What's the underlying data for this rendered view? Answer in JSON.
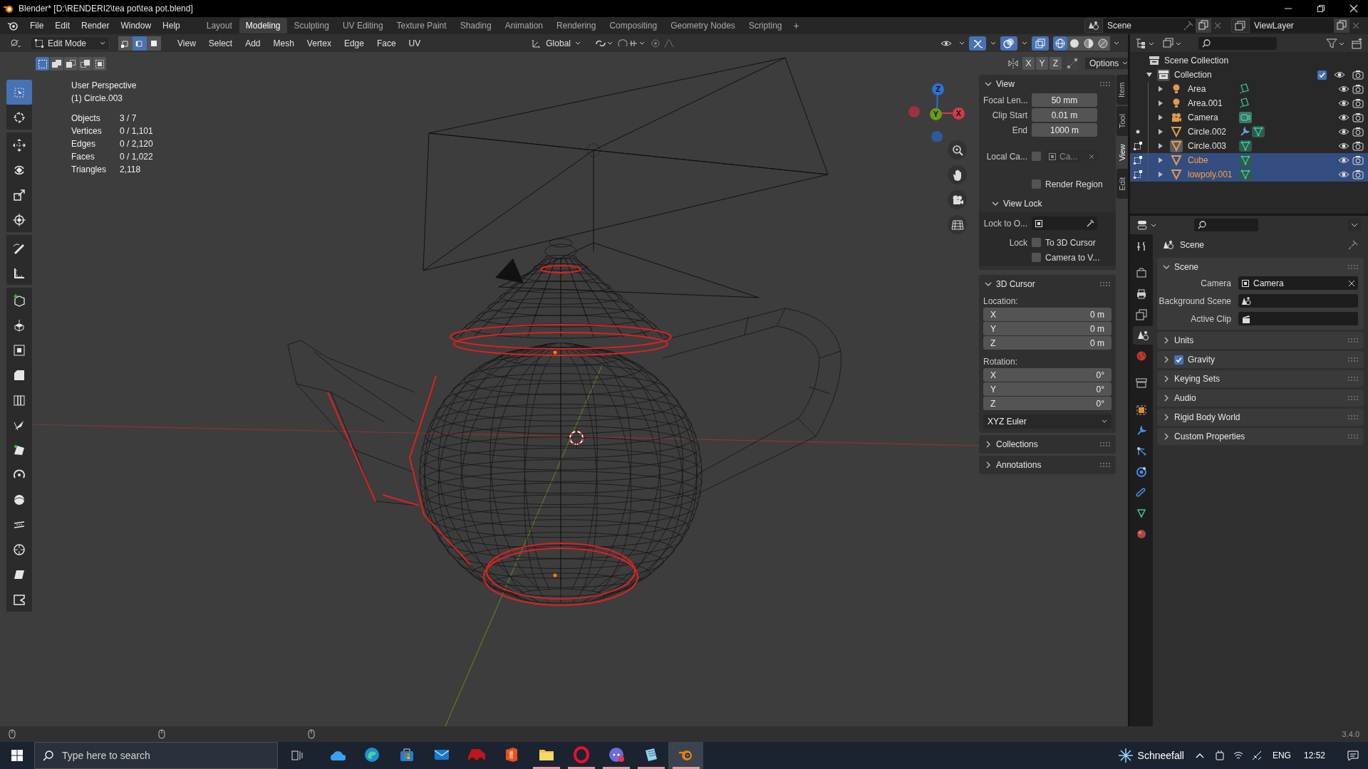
{
  "window": {
    "title": "Blender* [D:\\RENDERI2\\tea pot\\tea pot.blend]"
  },
  "menu": [
    "File",
    "Edit",
    "Render",
    "Window",
    "Help"
  ],
  "workspaces": [
    {
      "label": "Layout",
      "selected": false
    },
    {
      "label": "Modeling",
      "selected": true
    },
    {
      "label": "Sculpting",
      "selected": false
    },
    {
      "label": "UV Editing",
      "selected": false
    },
    {
      "label": "Texture Paint",
      "selected": false
    },
    {
      "label": "Shading",
      "selected": false
    },
    {
      "label": "Animation",
      "selected": false
    },
    {
      "label": "Rendering",
      "selected": false
    },
    {
      "label": "Compositing",
      "selected": false
    },
    {
      "label": "Geometry Nodes",
      "selected": false
    },
    {
      "label": "Scripting",
      "selected": false
    }
  ],
  "add_workspace": "+",
  "scene": {
    "name": "Scene"
  },
  "view_layer": {
    "name": "ViewLayer"
  },
  "viewport_header": {
    "mode": "Edit Mode",
    "select_modes": [
      {
        "kind": "vertex",
        "selected": false
      },
      {
        "kind": "edge",
        "selected": true
      },
      {
        "kind": "face",
        "selected": false
      }
    ],
    "menus": [
      "View",
      "Select",
      "Add",
      "Mesh",
      "Vertex",
      "Edge",
      "Face",
      "UV"
    ],
    "orientation": "Global",
    "toggles": [
      {
        "kind": "visibility",
        "on": false
      },
      {
        "kind": "gizmo",
        "on": true
      },
      {
        "kind": "overlay",
        "on": true
      },
      {
        "kind": "xray",
        "on": true
      }
    ],
    "shading": [
      {
        "kind": "wireframe",
        "selected": true
      },
      {
        "kind": "solid",
        "selected": false
      },
      {
        "kind": "material",
        "selected": false
      },
      {
        "kind": "rendered",
        "selected": false
      }
    ],
    "select_boxes": [
      {
        "kind": "new",
        "selected": true
      },
      {
        "kind": "extend",
        "selected": false
      },
      {
        "kind": "subtract",
        "selected": false
      },
      {
        "kind": "invert",
        "selected": false
      },
      {
        "kind": "intersect",
        "selected": false
      }
    ],
    "mirror_axes": [
      {
        "label": "X",
        "selected": false
      },
      {
        "label": "Y",
        "selected": false
      },
      {
        "label": "Z",
        "selected": false
      }
    ],
    "options": "Options"
  },
  "overlay_info": {
    "view": "User Perspective",
    "object": "(1) Circle.003",
    "stats": [
      {
        "label": "Objects",
        "value": "3 / 7"
      },
      {
        "label": "Vertices",
        "value": "0 / 1,101"
      },
      {
        "label": "Edges",
        "value": "0 / 2,120"
      },
      {
        "label": "Faces",
        "value": "0 / 1,022"
      },
      {
        "label": "Triangles",
        "value": "2,118"
      }
    ]
  },
  "tools": [
    {
      "kind": "select",
      "selected": true
    },
    {
      "kind": "cursor",
      "selected": false
    },
    {
      "kind": "move",
      "selected": false
    },
    {
      "kind": "rotate",
      "selected": false
    },
    {
      "kind": "scale",
      "selected": false
    },
    {
      "kind": "transform",
      "selected": false
    },
    {
      "kind": "annotate",
      "selected": false
    },
    {
      "kind": "measure",
      "selected": false
    },
    {
      "kind": "add_cube",
      "selected": false
    },
    {
      "kind": "extrude",
      "selected": false
    },
    {
      "kind": "inset",
      "selected": false
    },
    {
      "kind": "bevel",
      "selected": false
    },
    {
      "kind": "loop_cut",
      "selected": false
    },
    {
      "kind": "knife",
      "selected": false
    },
    {
      "kind": "poly_build",
      "selected": false
    },
    {
      "kind": "spin",
      "selected": false
    },
    {
      "kind": "smooth",
      "selected": false
    },
    {
      "kind": "edge_slide",
      "selected": false
    },
    {
      "kind": "shrink",
      "selected": false
    },
    {
      "kind": "shear",
      "selected": false
    },
    {
      "kind": "rip",
      "selected": false
    }
  ],
  "nav_gizmo": [
    {
      "label": "Z",
      "color": "#2f6fd0"
    },
    {
      "label": "Y",
      "color": "#6a9a1f"
    },
    {
      "label": "X",
      "color": "#d43a4a"
    }
  ],
  "n_panel": {
    "tabs": [
      {
        "label": "Item",
        "selected": false
      },
      {
        "label": "Tool",
        "selected": false
      },
      {
        "label": "View",
        "selected": true
      },
      {
        "label": "Edit",
        "selected": false
      }
    ],
    "view": {
      "title": "View",
      "expanded": true,
      "fields": [
        {
          "label": "Focal Len...",
          "value": "50 mm"
        },
        {
          "label": "Clip Start",
          "value": "0.01 m"
        },
        {
          "label": "End",
          "value": "1000 m"
        }
      ],
      "local_camera": {
        "label": "Local Ca...",
        "checked": false,
        "value": "Ca..."
      },
      "render_region": {
        "label": "Render Region",
        "checked": false
      }
    },
    "view_lock": {
      "title": "View Lock",
      "expanded": true,
      "lock_to_object": "Lock to O...",
      "lock_label": "Lock",
      "checks": [
        {
          "label": "To 3D Cursor",
          "checked": false
        },
        {
          "label": "Camera to V...",
          "checked": false
        }
      ]
    },
    "cursor": {
      "title": "3D Cursor",
      "expanded": true,
      "location_label": "Location:",
      "location": [
        {
          "axis": "X",
          "value": "0 m"
        },
        {
          "axis": "Y",
          "value": "0 m"
        },
        {
          "axis": "Z",
          "value": "0 m"
        }
      ],
      "rotation_label": "Rotation:",
      "rotation": [
        {
          "axis": "X",
          "value": "0°"
        },
        {
          "axis": "Y",
          "value": "0°"
        },
        {
          "axis": "Z",
          "value": "0°"
        }
      ],
      "rotation_mode": "XYZ Euler"
    },
    "collapsed": [
      {
        "title": "Collections",
        "expanded": false
      },
      {
        "title": "Annotations",
        "expanded": false
      }
    ]
  },
  "outliner": {
    "root": "Scene Collection",
    "collection": {
      "name": "Collection",
      "expanded": true,
      "checked": true,
      "children": [
        {
          "name": "Area",
          "kind": "light",
          "in_edit_mode": false,
          "editable": false,
          "active": false,
          "selected": false,
          "modifier": false
        },
        {
          "name": "Area.001",
          "kind": "light",
          "in_edit_mode": false,
          "editable": false,
          "active": false,
          "selected": false,
          "modifier": false
        },
        {
          "name": "Camera",
          "kind": "camera",
          "in_edit_mode": false,
          "editable": false,
          "active": false,
          "selected": false,
          "modifier": false
        },
        {
          "name": "Circle.002",
          "kind": "mesh",
          "in_edit_mode": false,
          "editable": true,
          "active": false,
          "selected": false,
          "modifier": true
        },
        {
          "name": "Circle.003",
          "kind": "mesh",
          "in_edit_mode": true,
          "editable": true,
          "active": true,
          "selected": false,
          "modifier": false
        },
        {
          "name": "Cube",
          "kind": "mesh",
          "in_edit_mode": true,
          "editable": true,
          "active": false,
          "selected": true,
          "modifier": false
        },
        {
          "name": "lowpoly.001",
          "kind": "mesh",
          "in_edit_mode": true,
          "editable": true,
          "active": false,
          "selected": true,
          "modifier": false
        }
      ]
    }
  },
  "properties": {
    "tabs": [
      {
        "kind": "tool",
        "selected": false
      },
      {
        "kind": "render",
        "selected": false
      },
      {
        "kind": "output",
        "selected": false
      },
      {
        "kind": "view_layer",
        "selected": false
      },
      {
        "kind": "scene",
        "selected": true
      },
      {
        "kind": "world",
        "selected": false
      },
      {
        "kind": "collection",
        "selected": false
      },
      {
        "kind": "object",
        "selected": false
      },
      {
        "kind": "modifiers",
        "selected": false
      },
      {
        "kind": "particles",
        "selected": false
      },
      {
        "kind": "physics",
        "selected": false
      },
      {
        "kind": "constraints",
        "selected": false
      },
      {
        "kind": "data",
        "selected": false
      },
      {
        "kind": "material",
        "selected": false
      }
    ],
    "context": "Scene",
    "section": {
      "title": "Scene",
      "expanded": true,
      "camera_label": "Camera",
      "camera": "Camera",
      "background_label": "Background Scene",
      "clip_label": "Active Clip"
    },
    "panels": [
      {
        "title": "Units",
        "kind": "plain",
        "expanded": false
      },
      {
        "title": "Gravity",
        "kind": "checkbox",
        "checked": true,
        "expanded": false
      },
      {
        "title": "Keying Sets",
        "kind": "plain",
        "expanded": false
      },
      {
        "title": "Audio",
        "kind": "plain",
        "expanded": false
      },
      {
        "title": "Rigid Body World",
        "kind": "plain",
        "expanded": false
      },
      {
        "title": "Custom Properties",
        "kind": "plain",
        "expanded": false
      }
    ]
  },
  "status_bar": {
    "version": "3.4.0"
  },
  "taskbar": {
    "search_placeholder": "Type here to search",
    "apps": [
      {
        "kind": "cloud",
        "running": false,
        "active": false
      },
      {
        "kind": "edge",
        "running": false,
        "active": false
      },
      {
        "kind": "store",
        "running": false,
        "active": false
      },
      {
        "kind": "mail",
        "running": false,
        "active": false
      },
      {
        "kind": "car",
        "running": false,
        "active": false
      },
      {
        "kind": "office",
        "running": false,
        "active": false
      },
      {
        "kind": "files",
        "running": true,
        "active": false
      },
      {
        "kind": "opera",
        "running": true,
        "active": false
      },
      {
        "kind": "chat",
        "running": true,
        "active": false
      },
      {
        "kind": "notes",
        "running": true,
        "active": false
      },
      {
        "kind": "blender",
        "running": true,
        "active": true
      }
    ],
    "weather": "Schneefall",
    "language": "ENG",
    "time": "12:52"
  }
}
